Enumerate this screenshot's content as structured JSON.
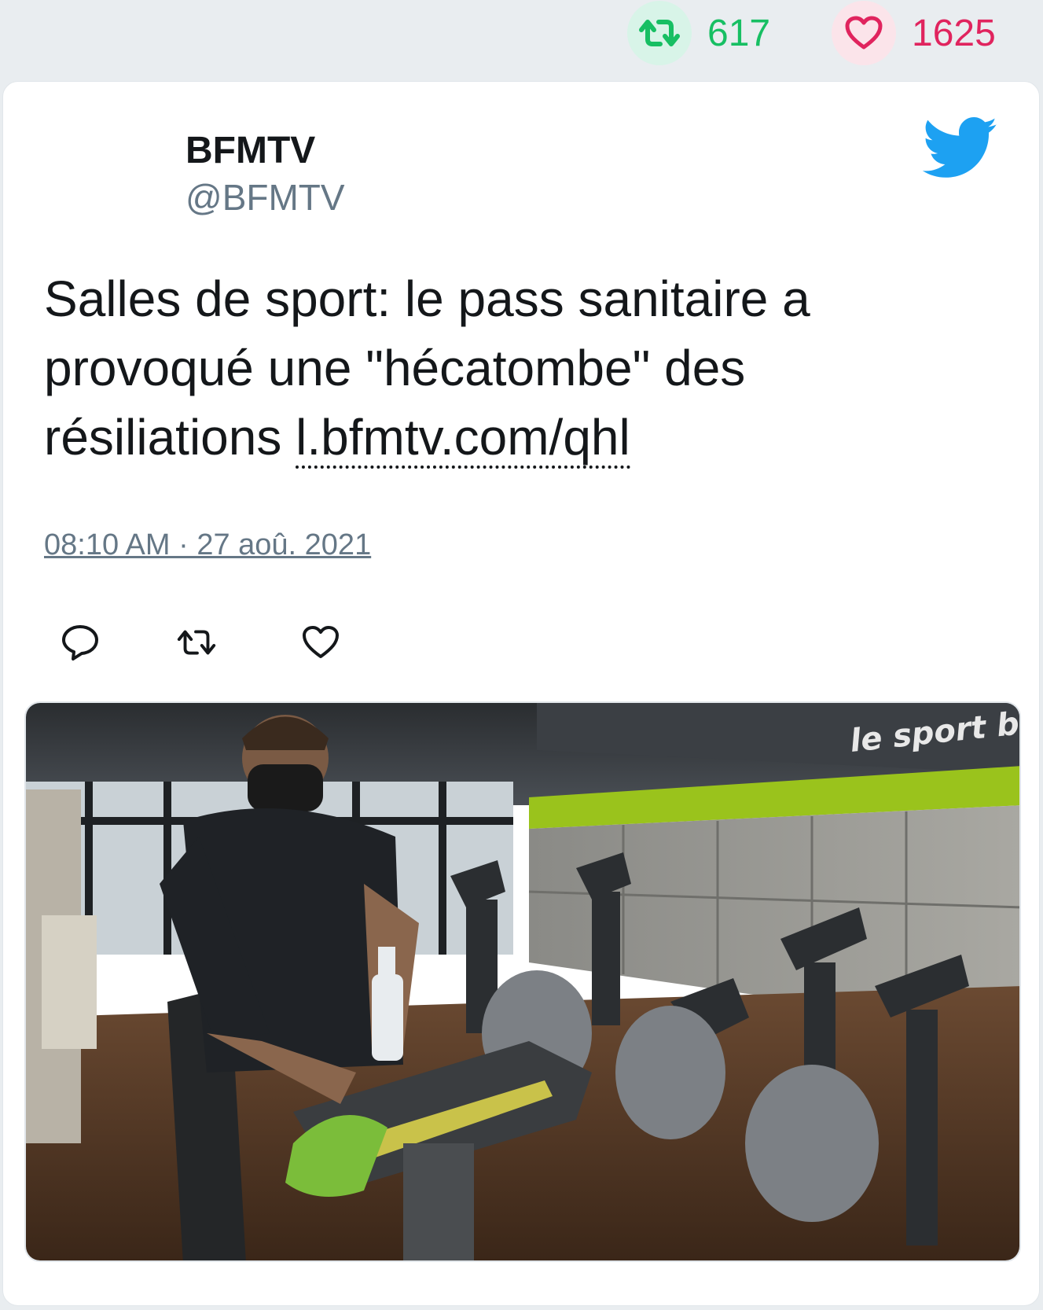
{
  "stats": {
    "retweets": "617",
    "likes": "1625"
  },
  "tweet": {
    "author_name": "BFMTV",
    "author_handle": "@BFMTV",
    "text": "Salles de sport: le pass sanitaire a provoqué une \"hécatombe\" des résiliations ",
    "link": "l.bfmtv.com/qhl",
    "timestamp": "08:10 AM · 27 aoû. 2021"
  },
  "media": {
    "signage_text": "le sport bo"
  },
  "colors": {
    "retweet_green": "#17bf63",
    "like_red": "#e0245e",
    "twitter_blue": "#1da1f2",
    "muted_gray": "#657786"
  },
  "icons": [
    "retweet-icon",
    "heart-icon",
    "twitter-bird-icon",
    "reply-icon"
  ]
}
